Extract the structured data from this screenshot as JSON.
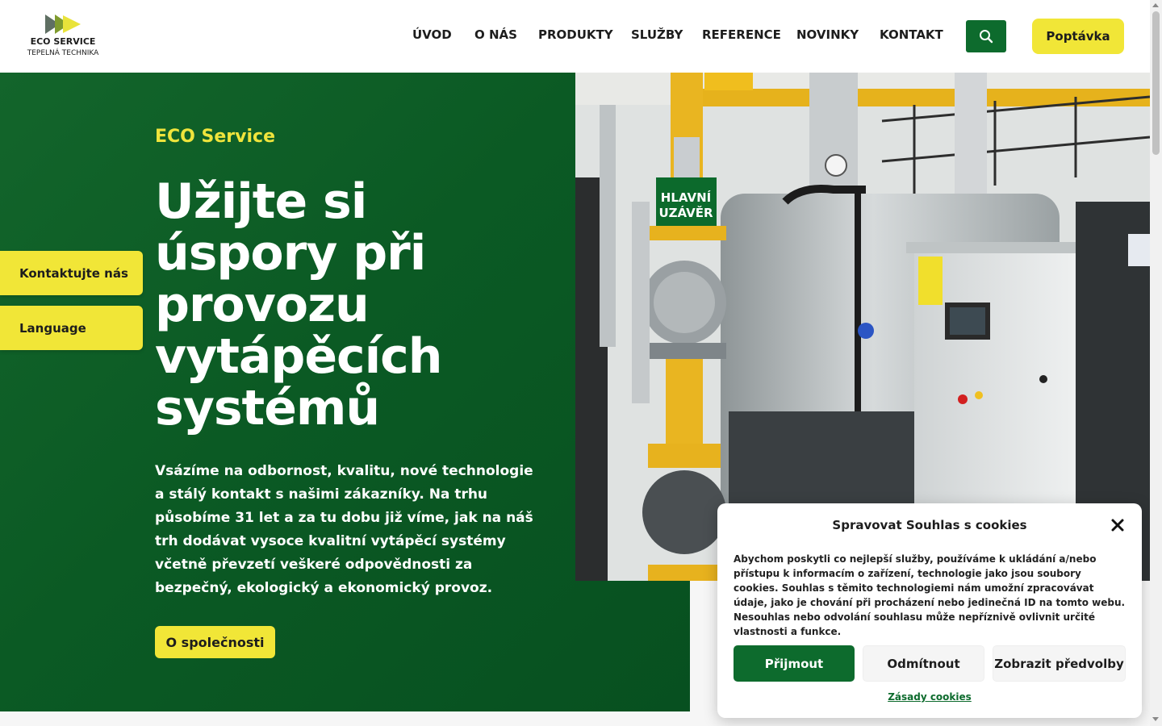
{
  "header": {
    "logo": {
      "brand": "ECO SERVICE",
      "sub": "TEPELNÁ TECHNIKA",
      "icon": "double-arrow-logo"
    },
    "nav": [
      {
        "label": "ÚVOD"
      },
      {
        "label": "O NÁS"
      },
      {
        "label": "PRODUKTY"
      },
      {
        "label": "SLUŽBY"
      },
      {
        "label": "REFERENCE"
      },
      {
        "label": "NOVINKY"
      },
      {
        "label": "KONTAKT"
      }
    ],
    "search_icon": "search-icon",
    "cta_label": "Poptávka"
  },
  "side_tabs": {
    "contact_label": "Kontaktujte nás",
    "language_label": "Language"
  },
  "hero": {
    "eyebrow": "ECO Service",
    "headline_lines": [
      "Užijte si",
      "úspory při",
      "provozu",
      "vytápěcích",
      "systémů"
    ],
    "lead": "Vsázíme na odbornost, kvalitu, nové technologie a stálý kontakt s našimi zákazníky. Na trhu působíme 31 let a za tu dobu již víme, jak na náš trh dodávat vysoce kvalitní vytápěcí systémy včetně převzetí veškeré odpovědnosti za bezpečný, ekologický a ekonomický provoz.",
    "button_label": "O společnosti",
    "photo_sign": [
      "HLAVNÍ",
      "UZÁVĚR"
    ]
  },
  "cookie": {
    "title": "Spravovat Souhlas s cookies",
    "text": "Abychom poskytli co nejlepší služby, používáme k ukládání a/nebo přístupu k informacím o zařízení, technologie jako jsou soubory cookies. Souhlas s těmito technologiemi nám umožní zpracovávat údaje, jako je chování při procházení nebo jedinečná ID na tomto webu. Nesouhlas nebo odvolání souhlasu může nepříznivě ovlivnit určité vlastnosti a funkce.",
    "accept_label": "Přijmout",
    "deny_label": "Odmítnout",
    "prefs_label": "Zobrazit předvolby",
    "policy_label": "Zásady cookies"
  },
  "colors": {
    "brand_green": "#0d6b2d",
    "accent_yellow": "#f1e637",
    "eyebrow_yellow": "#efe43c"
  }
}
